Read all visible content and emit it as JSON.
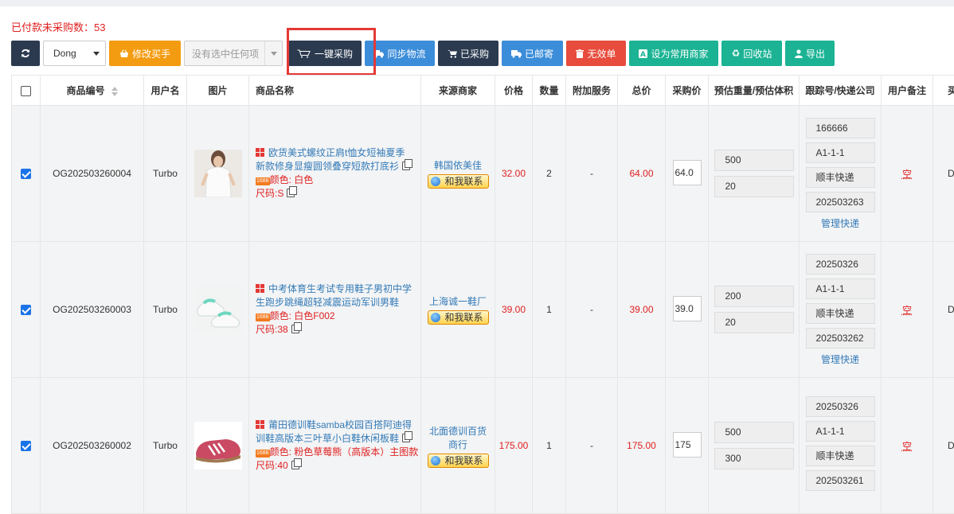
{
  "summary": {
    "label": "已付款未采购数：",
    "count": "53"
  },
  "toolbar": {
    "user_select": "Dong",
    "edit_buyer": "修改买手",
    "selection_placeholder": "没有选中任何项",
    "one_click_purchase": "一键采购",
    "sync_logistics": "同步物流",
    "purchased": "已采购",
    "mailed": "已邮寄",
    "invalid": "无效单",
    "set_common_merchant": "设为常用商家",
    "recycle_bin": "回收站",
    "export": "导出"
  },
  "table": {
    "headers": [
      "商品编号",
      "用户名",
      "图片",
      "商品名称",
      "来源商家",
      "价格",
      "数量",
      "附加服务",
      "总价",
      "采购价",
      "预估重量/预估体积",
      "跟踪号/快递公司",
      "用户备注",
      "买手"
    ],
    "contact_label": "和我联系",
    "manage_label": "管理快递",
    "badge_1688": "1688",
    "rows": [
      {
        "order_no": "OG202503260004",
        "username": "Turbo",
        "product_name": "欧货美式螺纹正肩t恤女短袖夏季新款修身显瘦圆领叠穿短款打底衫",
        "color": "颜色: 白色",
        "size": "尺码:S",
        "merchant": "韩国依美佳",
        "price": "32.00",
        "quantity": "2",
        "extra": "-",
        "total": "64.00",
        "purchase_price": "64.0",
        "weight": "500",
        "volume": "20",
        "tracking": [
          "166666",
          "A1-1-1",
          "顺丰快递",
          "202503263"
        ],
        "note": "空",
        "buyer": "Dong"
      },
      {
        "order_no": "OG202503260003",
        "username": "Turbo",
        "product_name": "中考体育生考试专用鞋子男初中学生跑步跳绳超轻减震运动军训男鞋",
        "color": "颜色: 白色F002",
        "size": "尺码:38",
        "merchant": "上海诚一鞋厂",
        "price": "39.00",
        "quantity": "1",
        "extra": "-",
        "total": "39.00",
        "purchase_price": "39.0",
        "weight": "200",
        "volume": "20",
        "tracking": [
          "20250326",
          "A1-1-1",
          "顺丰快递",
          "202503262"
        ],
        "note": "空",
        "buyer": "Dong"
      },
      {
        "order_no": "OG202503260002",
        "username": "Turbo",
        "product_name": "莆田德训鞋samba校园百搭阿迪得训鞋高版本三叶草小白鞋休闲板鞋",
        "color": "颜色: 粉色草莓熊（高版本）主图款",
        "size": "尺码:40",
        "merchant": "北面德训百货商行",
        "price": "175.00",
        "quantity": "1",
        "extra": "-",
        "total": "175.00",
        "purchase_price": "175",
        "weight": "500",
        "volume": "300",
        "tracking": [
          "20250326",
          "A1-1-1",
          "顺丰快递",
          "202503261"
        ],
        "note": "空",
        "buyer": "Dong"
      }
    ]
  },
  "colors": {
    "dark": "#2b3a4f",
    "orange": "#f39c12",
    "blue": "#3c8dd9",
    "red": "#e74c3c",
    "green": "#1bb394",
    "highlight": "#e53935"
  }
}
